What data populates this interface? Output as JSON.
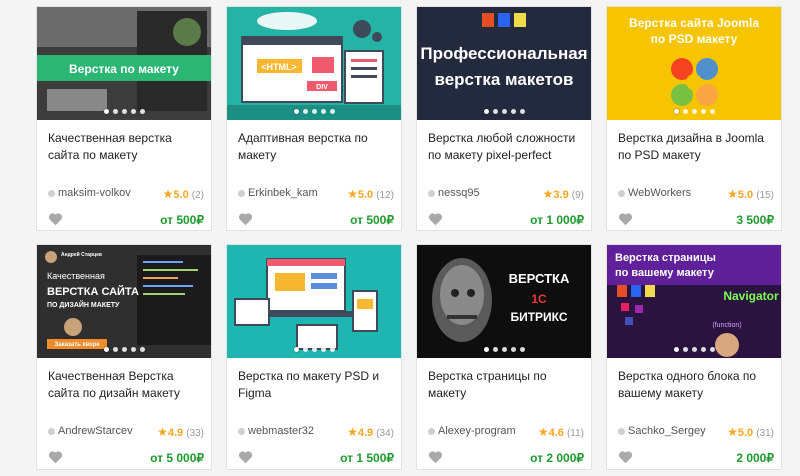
{
  "colors": {
    "price": "#1f9a2f",
    "star": "#f5a623"
  },
  "cards": [
    {
      "title": "Качественная верстка сайта по макету",
      "seller": "maksim-volkov",
      "rating": "5.0",
      "reviews": "(2)",
      "price": "от 500₽",
      "thumb_text": [
        "Верстка по макету"
      ]
    },
    {
      "title": "Адаптивная верстка по макету",
      "seller": "Erkinbek_kam",
      "rating": "5.0",
      "reviews": "(12)",
      "price": "от 500₽",
      "thumb_text": [
        "<HTML>",
        "DIV"
      ]
    },
    {
      "title": "Верстка любой сложности по макету pixel-perfect",
      "seller": "nessq95",
      "rating": "3.9",
      "reviews": "(9)",
      "price": "от 1 000₽",
      "thumb_text": [
        "Профессиональная",
        "верстка макетов"
      ]
    },
    {
      "title": "Верстка дизайна в Joomla по PSD макету",
      "seller": "WebWorkers",
      "rating": "5.0",
      "reviews": "(15)",
      "price": "3 500₽",
      "thumb_text": [
        "Верстка сайта Joomla",
        "по PSD макету"
      ]
    },
    {
      "title": "Качественная Верстка сайта по дизайн макету",
      "seller": "AndrewStarcev",
      "rating": "4.9",
      "reviews": "(33)",
      "price": "от 5 000₽",
      "thumb_text": [
        "Андрей Старцев",
        "Качественная",
        "ВЕРСТКА САЙТА",
        "ПО ДИЗАЙН МАКЕТУ",
        "Заказать кворк"
      ]
    },
    {
      "title": "Верстка по макету PSD и Figma",
      "seller": "webmaster32",
      "rating": "4.9",
      "reviews": "(34)",
      "price": "от 1 500₽",
      "thumb_text": []
    },
    {
      "title": "Верстка страницы по макету",
      "seller": "Alexey-program",
      "rating": "4.6",
      "reviews": "(11)",
      "price": "от 2 000₽",
      "thumb_text": [
        "ВЕРСТКА",
        "1С",
        "БИТРИКС"
      ]
    },
    {
      "title": "Верстка одного блока по вашему макету",
      "seller": "Sachko_Sergey",
      "rating": "5.0",
      "reviews": "(31)",
      "price": "2 000₽",
      "thumb_text": [
        "Верстка страницы",
        "по вашему макету",
        "Navigator",
        "(function)"
      ]
    }
  ]
}
